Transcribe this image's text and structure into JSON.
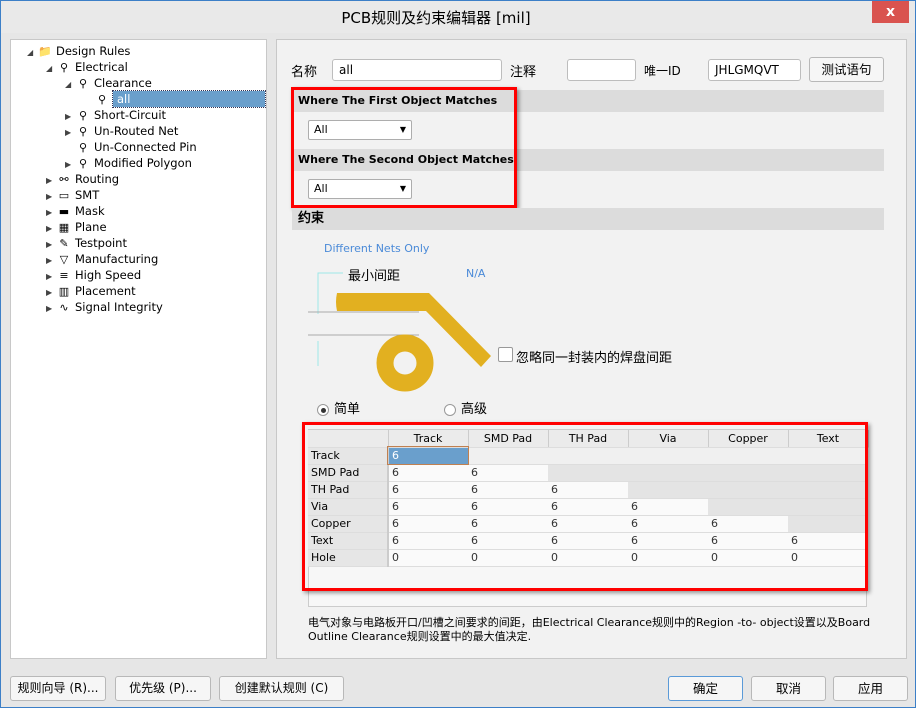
{
  "window": {
    "title": "PCB规则及约束编辑器 [mil]",
    "close": "x"
  },
  "tree": [
    {
      "label": "Design Rules",
      "icon": "design-rules-folder-icon"
    },
    {
      "label": "Electrical",
      "icon": "electrical-rule-icon"
    },
    {
      "label": "Clearance",
      "icon": "clearance-rule-icon"
    },
    {
      "label": "all",
      "icon": "rule-icon",
      "selected": true
    },
    {
      "label": "Short-Circuit",
      "icon": "rule-icon"
    },
    {
      "label": "Un-Routed Net",
      "icon": "rule-icon"
    },
    {
      "label": "Un-Connected Pin",
      "icon": "rule-icon"
    },
    {
      "label": "Modified Polygon",
      "icon": "rule-icon"
    },
    {
      "label": "Routing",
      "icon": "routing-icon"
    },
    {
      "label": "SMT",
      "icon": "smt-icon"
    },
    {
      "label": "Mask",
      "icon": "mask-icon"
    },
    {
      "label": "Plane",
      "icon": "plane-icon"
    },
    {
      "label": "Testpoint",
      "icon": "testpoint-icon"
    },
    {
      "label": "Manufacturing",
      "icon": "manufacturing-icon"
    },
    {
      "label": "High Speed",
      "icon": "high-speed-icon"
    },
    {
      "label": "Placement",
      "icon": "placement-icon"
    },
    {
      "label": "Signal Integrity",
      "icon": "signal-integrity-icon"
    }
  ],
  "form": {
    "name_label": "名称",
    "name_value": "all",
    "comment_label": "注释",
    "comment_value": "",
    "id_label": "唯一ID",
    "id_value": "JHLGMQVT",
    "test_button": "测试语句"
  },
  "first_match": {
    "title": "Where The First Object Matches",
    "value": "All"
  },
  "second_match": {
    "title": "Where The Second Object Matches",
    "value": "All"
  },
  "constraints": {
    "title": "约束",
    "net_scope": "Different Nets Only",
    "min_clearance_label": "最小间距",
    "min_clearance_value": "N/A",
    "ignore_pads_label": "忽略同一封装内的焊盘间距",
    "ignore_pads_checked": false,
    "mode_simple": "简单",
    "mode_advanced": "高级",
    "mode_selected": "simple",
    "colors": {
      "copper": "#e2b020"
    }
  },
  "grid": {
    "columns": [
      "Track",
      "SMD Pad",
      "TH Pad",
      "Via",
      "Copper",
      "Text"
    ],
    "rows": [
      {
        "label": "Track",
        "values": [
          "6",
          "",
          "",
          "",
          "",
          ""
        ]
      },
      {
        "label": "SMD Pad",
        "values": [
          "6",
          "6",
          "",
          "",
          "",
          ""
        ]
      },
      {
        "label": "TH Pad",
        "values": [
          "6",
          "6",
          "6",
          "",
          "",
          ""
        ]
      },
      {
        "label": "Via",
        "values": [
          "6",
          "6",
          "6",
          "6",
          "",
          ""
        ]
      },
      {
        "label": "Copper",
        "values": [
          "6",
          "6",
          "6",
          "6",
          "6",
          ""
        ]
      },
      {
        "label": "Text",
        "values": [
          "6",
          "6",
          "6",
          "6",
          "6",
          "6"
        ]
      },
      {
        "label": "Hole",
        "values": [
          "0",
          "0",
          "0",
          "0",
          "0",
          "0"
        ]
      }
    ]
  },
  "note": "电气对象与电路板开口/凹槽之间要求的间距，由Electrical Clearance规则中的Region -to- object设置以及Board Outline Clearance规则设置中的最大值决定.",
  "buttons": {
    "wizard": "规则向导 (R)...",
    "priority": "优先级 (P)...",
    "create_default": "创建默认规则 (C)",
    "ok": "确定",
    "cancel": "取消",
    "apply": "应用"
  }
}
